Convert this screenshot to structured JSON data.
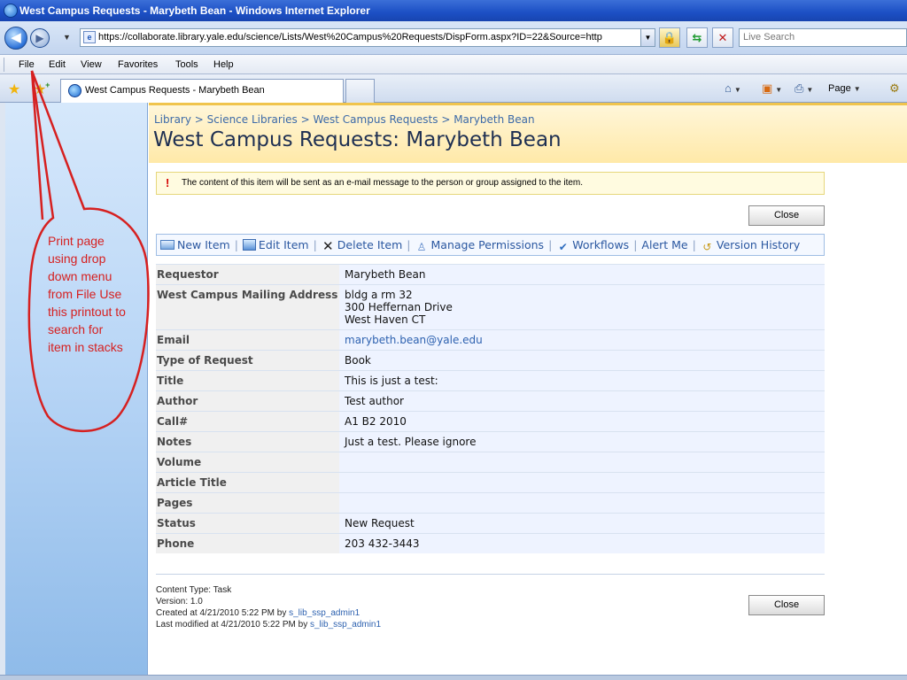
{
  "window": {
    "title": "West Campus Requests - Marybeth Bean - Windows Internet Explorer"
  },
  "address_bar": {
    "url": "https://collaborate.library.yale.edu/science/Lists/West%20Campus%20Requests/DispForm.aspx?ID=22&Source=http",
    "search_placeholder": "Live Search"
  },
  "menu": {
    "items": [
      "File",
      "Edit",
      "View",
      "Favorites",
      "Tools",
      "Help"
    ]
  },
  "tabs": {
    "active_label": "West Campus Requests - Marybeth Bean"
  },
  "command_bar": {
    "page_label": "Page"
  },
  "page": {
    "breadcrumb": "Library > Science Libraries > West Campus Requests > Marybeth Bean",
    "title": "West Campus Requests: Marybeth Bean",
    "notice": "The content of this item will be sent as an e-mail message to the person or group assigned to the item.",
    "close_label": "Close"
  },
  "toolbar": {
    "new_item": "New Item",
    "edit_item": "Edit Item",
    "delete_item": "Delete Item",
    "manage_permissions": "Manage Permissions",
    "workflows": "Workflows",
    "alert_me": "Alert Me",
    "version_history": "Version History"
  },
  "fields": [
    {
      "label": "Requestor",
      "value": "Marybeth Bean"
    },
    {
      "label": "West Campus Mailing Address",
      "value": "bldg a  rm 32\n300 Heffernan Drive\nWest Haven CT"
    },
    {
      "label": "Email",
      "value": "marybeth.bean@yale.edu"
    },
    {
      "label": "Type of Request",
      "value": "Book"
    },
    {
      "label": "Title",
      "value": "This is just a test:"
    },
    {
      "label": "Author",
      "value": "Test author"
    },
    {
      "label": "Call#",
      "value": "A1 B2 2010"
    },
    {
      "label": "Notes",
      "value": "Just a test. Please ignore"
    },
    {
      "label": "Volume",
      "value": ""
    },
    {
      "label": "Article Title",
      "value": ""
    },
    {
      "label": "Pages",
      "value": ""
    },
    {
      "label": "Status",
      "value": "New Request"
    },
    {
      "label": "Phone",
      "value": "203 432-3443"
    }
  ],
  "footer": {
    "content_type": "Content Type: Task",
    "version": "Version: 1.0",
    "created_prefix": "Created at 4/21/2010 5:22 PM  by ",
    "created_by": "s_lib_ssp_admin1",
    "modified_prefix": "Last modified at 4/21/2010 5:22 PM  by ",
    "modified_by": "s_lib_ssp_admin1"
  },
  "annotation": {
    "text": "Print page using drop down menu from File Use this printout to search for item in stacks",
    "color": "#d62020"
  },
  "colors": {
    "link": "#2e62b0",
    "title": "#1e2f52",
    "accent_band": "#ffe9a8"
  }
}
